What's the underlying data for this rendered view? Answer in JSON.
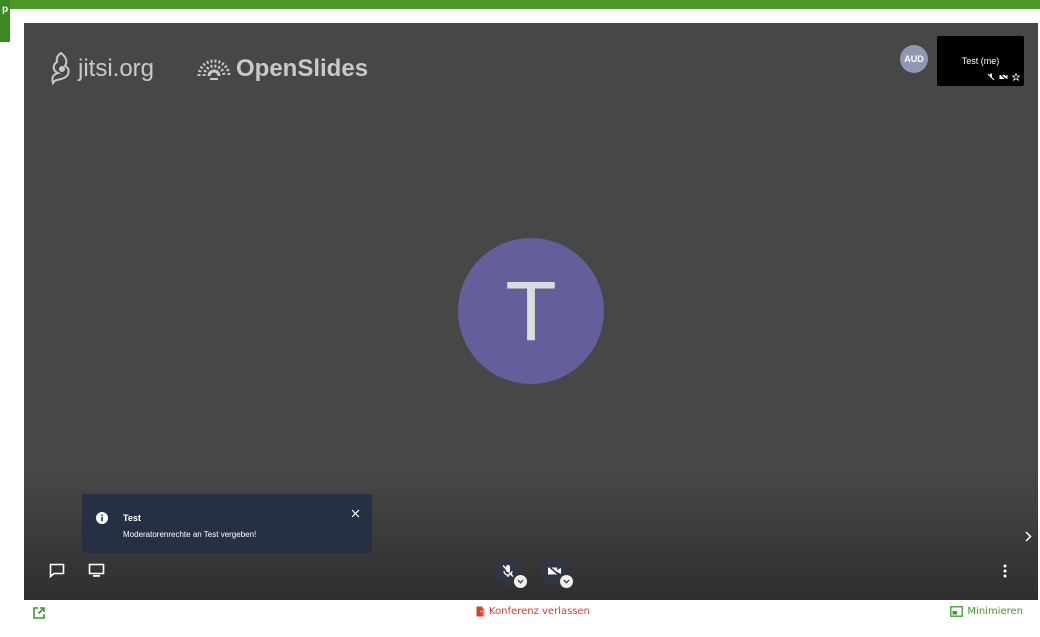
{
  "app": {
    "left_tab_letter": "p"
  },
  "watermarks": {
    "jitsi": "jitsi.org",
    "openslides": "OpenSlides"
  },
  "participant": {
    "avatar_initial": "T",
    "audio_badge": "AUD",
    "self_name": "Test (me)"
  },
  "notification": {
    "title": "Test",
    "message": "Moderatorenrechte an Test vergeben!"
  },
  "footer": {
    "leave_label": "Konferenz verlassen",
    "minimize_label": "Minimieren"
  },
  "colors": {
    "brand_green": "#4a9a2a",
    "danger_red": "#d3402f",
    "stage_bg": "#474747",
    "avatar_bg": "#625f9a",
    "toast_bg": "#253143"
  },
  "icons": {
    "chat": "chat-icon",
    "screenshare": "screen-share-icon",
    "mic": "microphone-muted-icon",
    "camera": "camera-off-icon",
    "more": "more-vertical-icon",
    "expand": "chevron-right-icon",
    "popout": "open-in-new-icon",
    "leave": "door-exit-icon",
    "minimize": "picture-in-picture-icon"
  }
}
